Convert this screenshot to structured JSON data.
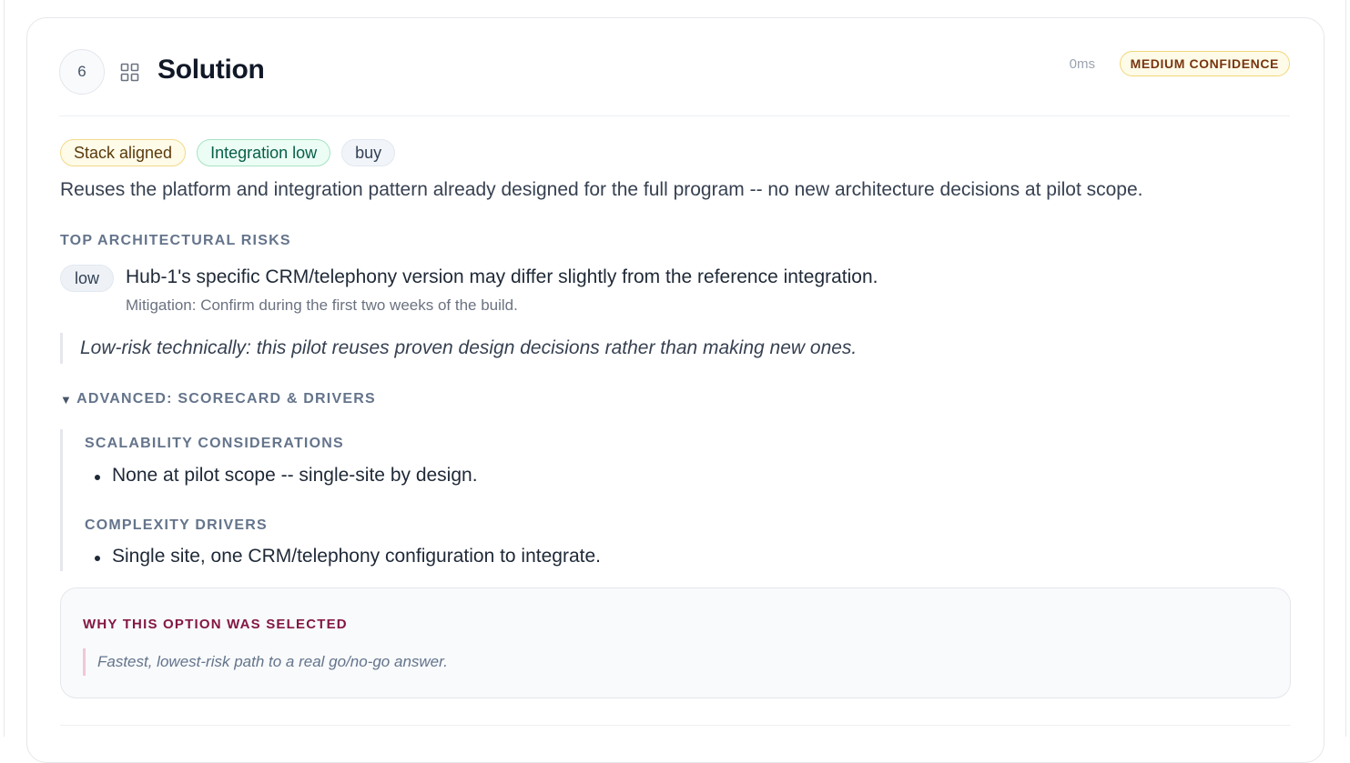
{
  "step": {
    "number": "6",
    "icon": "grid-icon"
  },
  "header": {
    "title": "Solution",
    "timing": "0ms",
    "confidence": "MEDIUM CONFIDENCE"
  },
  "tags": [
    {
      "label": "Stack aligned",
      "color": "#fefbe8"
    },
    {
      "label": "Integration low",
      "color": "#ecfdf5"
    },
    {
      "label": "buy",
      "color": "#f1f5f9"
    }
  ],
  "summary": "Reuses the platform and integration pattern already designed for the full program -- no new architecture decisions at pilot scope.",
  "risks": {
    "label": "TOP ARCHITECTURAL RISKS",
    "items": [
      {
        "level": "low",
        "text": "Hub-1's specific CRM/telephony version may differ slightly from the reference integration.",
        "mitigation": "Mitigation: Confirm during the first two weeks of the build."
      }
    ]
  },
  "assessment_note": "Low-risk technically: this pilot reuses proven design decisions rather than making new ones.",
  "advanced": {
    "toggle_label": "ADVANCED: SCORECARD & DRIVERS",
    "caret_icon": "caret-down-icon",
    "scalability_label": "SCALABILITY CONSIDERATIONS",
    "scalability_items": [
      "None at pilot scope -- single-site by design."
    ],
    "complexity_label": "COMPLEXITY DRIVERS",
    "complexity_items": [
      "Single site, one CRM/telephony configuration to integrate."
    ]
  },
  "why": {
    "label": "WHY THIS OPTION WAS SELECTED",
    "quote": "Fastest, lowest-risk path to a real go/no-go answer."
  },
  "colors": {
    "accent_why": "#831843",
    "confidence_border": "#f2d67a",
    "text_muted": "#64748b"
  }
}
